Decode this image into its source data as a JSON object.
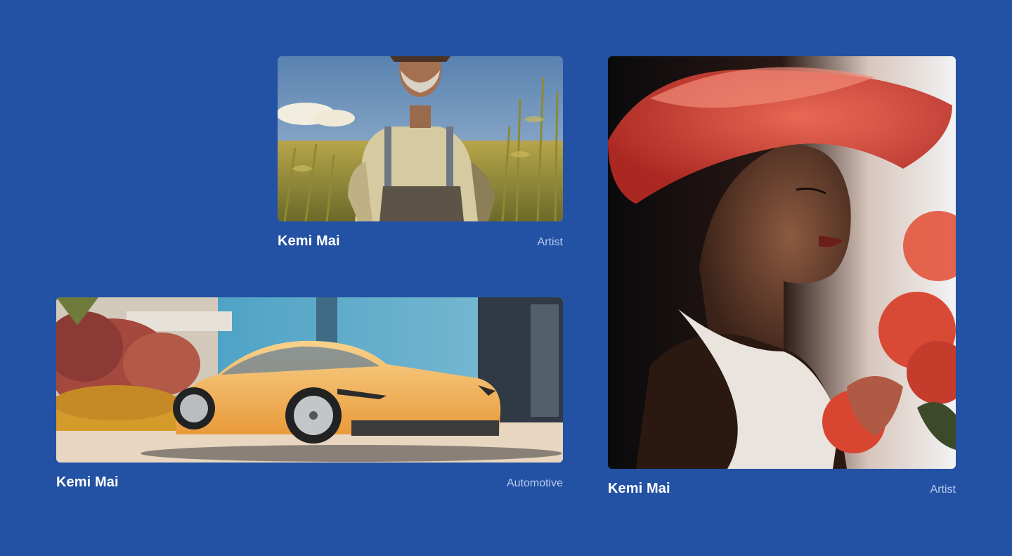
{
  "gallery": {
    "cards": [
      {
        "id": "farmer",
        "name": "Kemi Mai",
        "category": "Artist",
        "image": "farmer-in-cornfield-image"
      },
      {
        "id": "car",
        "name": "Kemi Mai",
        "category": "Automotive",
        "image": "yellow-sports-car-image"
      },
      {
        "id": "woman",
        "name": "Kemi Mai",
        "category": "Artist",
        "image": "woman-with-red-hat-image"
      }
    ]
  },
  "colors": {
    "background": "#2351a3",
    "name_text": "#ffffff",
    "category_text": "#b9cdf0"
  }
}
